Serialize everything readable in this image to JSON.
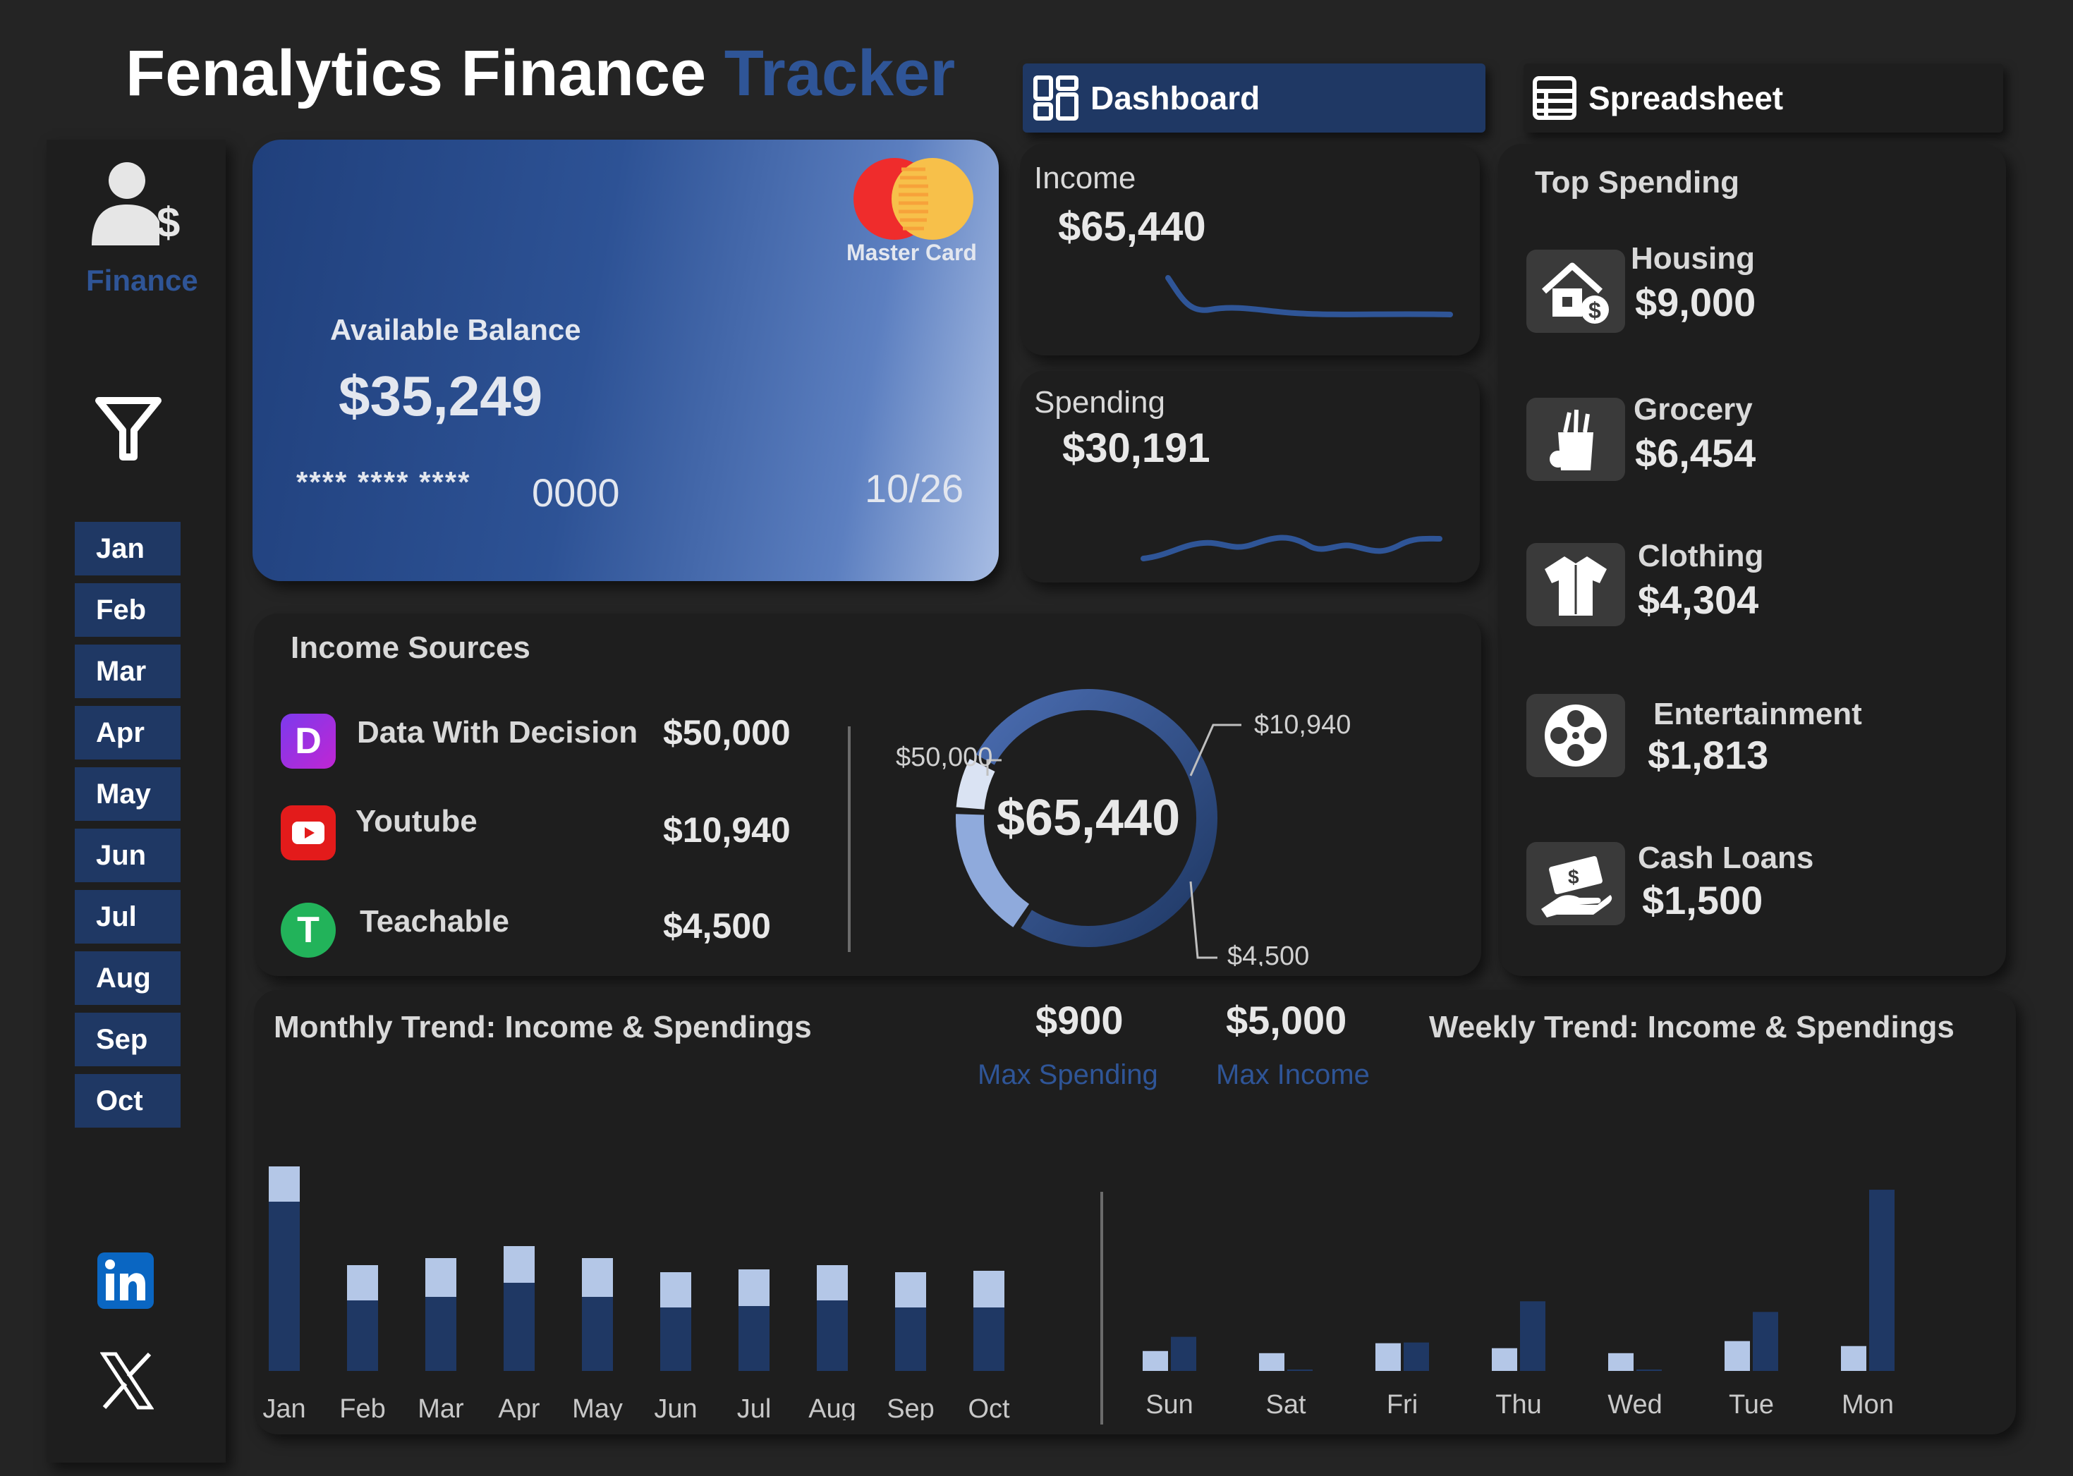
{
  "header": {
    "title_main": "Fenalytics Finance",
    "title_accent": "Tracker"
  },
  "tabs": [
    {
      "label": "Dashboard",
      "icon": "dashboard-grid-icon",
      "active": true
    },
    {
      "label": "Spreadsheet",
      "icon": "spreadsheet-icon",
      "active": false
    }
  ],
  "sidebar": {
    "profile_label": "Finance",
    "months": [
      "Jan",
      "Feb",
      "Mar",
      "Apr",
      "May",
      "Jun",
      "Jul",
      "Aug",
      "Sep",
      "Oct"
    ]
  },
  "card": {
    "brand": "Master Card",
    "balance_label": "Available Balance",
    "balance": "$35,249",
    "number_mask": "**** **** ****",
    "number_last": "0000",
    "expiry": "10/26"
  },
  "income": {
    "label": "Income",
    "value": "$65,440"
  },
  "spending": {
    "label": "Spending",
    "value": "$30,191"
  },
  "top_spending": {
    "title": "Top Spending",
    "items": [
      {
        "name": "Housing",
        "value": "$9,000",
        "icon": "house-dollar-icon"
      },
      {
        "name": "Grocery",
        "value": "$6,454",
        "icon": "grocery-bag-icon"
      },
      {
        "name": "Clothing",
        "value": "$4,304",
        "icon": "shirt-icon"
      },
      {
        "name": "Entertainment",
        "value": "$1,813",
        "icon": "film-reel-icon"
      },
      {
        "name": "Cash Loans",
        "value": "$1,500",
        "icon": "cash-hand-icon"
      }
    ]
  },
  "income_sources": {
    "title": "Income Sources",
    "items": [
      {
        "name": "Data With Decision",
        "value": "$50,000",
        "icon": "dwd-logo-icon"
      },
      {
        "name": "Youtube",
        "value": "$10,940",
        "icon": "youtube-icon"
      },
      {
        "name": "Teachable",
        "value": "$4,500",
        "icon": "teachable-icon"
      }
    ],
    "donut_total": "$65,440",
    "donut_labels": [
      "$50,000",
      "$10,940",
      "$4,500"
    ]
  },
  "trend": {
    "monthly_title": "Monthly Trend: Income & Spendings",
    "weekly_title": "Weekly Trend: Income & Spendings",
    "max_spending_value": "$900",
    "max_spending_label": "Max Spending",
    "max_income_value": "$5,000",
    "max_income_label": "Max Income"
  },
  "social": {
    "linkedin": "linkedin-icon",
    "x": "x-logo-icon"
  },
  "colors": {
    "background": "#242424",
    "panel": "#1e1e1e",
    "accent": "#2f5597",
    "navy": "#1f3864",
    "light_blue": "#b4c7e7",
    "donut_mid": "#8faadc"
  },
  "chart_data": [
    {
      "type": "bar",
      "title": "Monthly Trend: Income & Spendings",
      "categories": [
        "Jan",
        "Feb",
        "Mar",
        "Apr",
        "May",
        "Jun",
        "Jul",
        "Aug",
        "Sep",
        "Oct"
      ],
      "series": [
        {
          "values": [
            240,
            100,
            105,
            125,
            105,
            90,
            92,
            100,
            90,
            90
          ],
          "color": "#1f3864"
        },
        {
          "values": [
            50,
            50,
            55,
            52,
            55,
            50,
            52,
            50,
            50,
            52
          ],
          "color": "#b4c7e7"
        }
      ],
      "stacked": true,
      "ylim": [
        0,
        300
      ]
    },
    {
      "type": "bar",
      "title": "Weekly Trend: Income & Spendings",
      "categories": [
        "Sun",
        "Sat",
        "Fri",
        "Thu",
        "Wed",
        "Tue",
        "Mon"
      ],
      "series": [
        {
          "values": [
            280,
            250,
            390,
            320,
            250,
            420,
            350
          ],
          "color": "#b4c7e7"
        },
        {
          "values": [
            480,
            5,
            400,
            980,
            5,
            830,
            2550
          ],
          "color": "#1f3864"
        }
      ],
      "ylim": [
        0,
        2600
      ]
    }
  ]
}
